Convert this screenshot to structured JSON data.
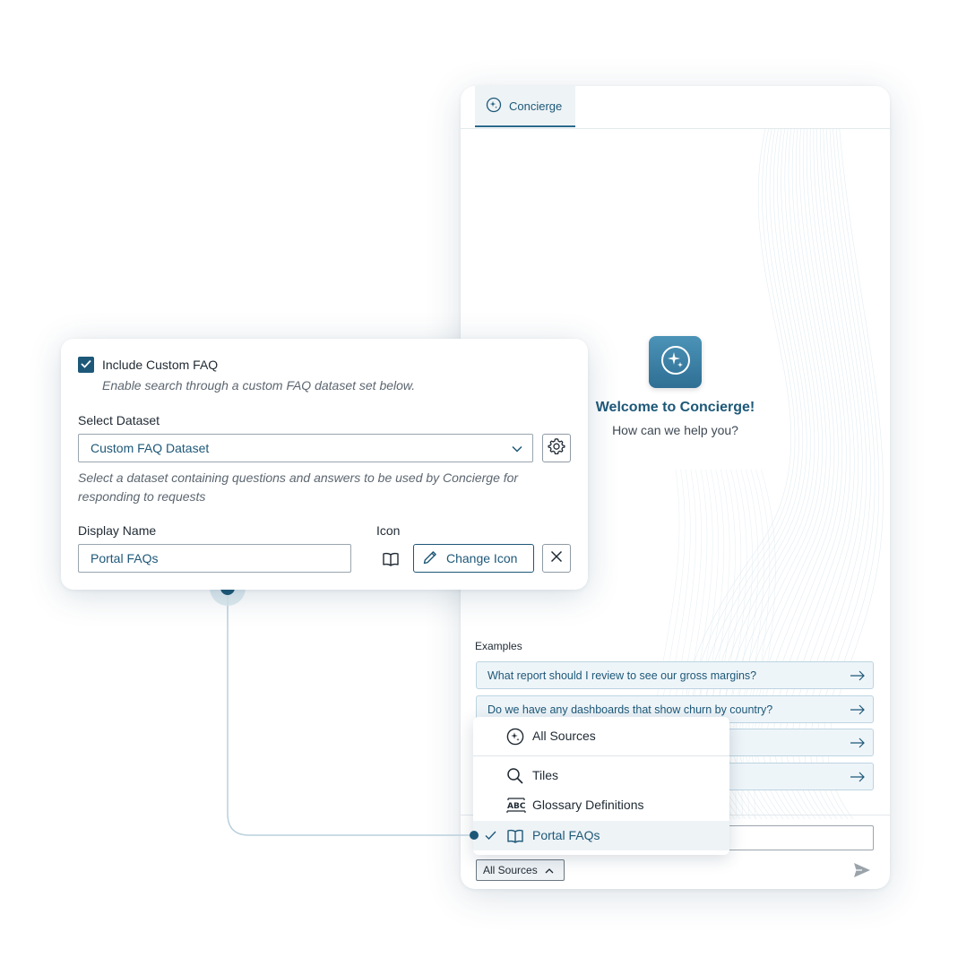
{
  "panel": {
    "tab_label": "Concierge",
    "welcome_title": "Welcome to Concierge!",
    "welcome_subtitle": "How can we help you?",
    "examples_label": "Examples",
    "examples": [
      "What report should I review to see our gross margins?",
      "Do we have any dashboards that show churn by country?",
      "",
      ""
    ],
    "sources_button_label": "All Sources",
    "composer_value": ""
  },
  "menu": {
    "items": [
      {
        "label": "All Sources",
        "icon": "sparkle-icon",
        "selected": false
      },
      {
        "label": "Tiles",
        "icon": "search-icon",
        "selected": false
      },
      {
        "label": "Glossary Definitions",
        "icon": "abc-icon",
        "selected": false
      },
      {
        "label": "Portal FAQs",
        "icon": "book-icon",
        "selected": true
      }
    ]
  },
  "card": {
    "include_label": "Include Custom FAQ",
    "include_checked": true,
    "include_help": "Enable search through a custom FAQ dataset set below.",
    "dataset_label": "Select Dataset",
    "dataset_value": "Custom FAQ Dataset",
    "dataset_help": "Select a dataset containing questions and answers to be used by Concierge for responding to requests",
    "display_name_label": "Display Name",
    "display_name_value": "Portal FAQs",
    "icon_label": "Icon",
    "icon_value": "book-icon",
    "change_icon_label": "Change Icon"
  },
  "colors": {
    "accent": "#1d5878",
    "tab_bg": "#eef3f6",
    "example_bg": "#eef5f9",
    "connector": "#b9d0dc"
  }
}
